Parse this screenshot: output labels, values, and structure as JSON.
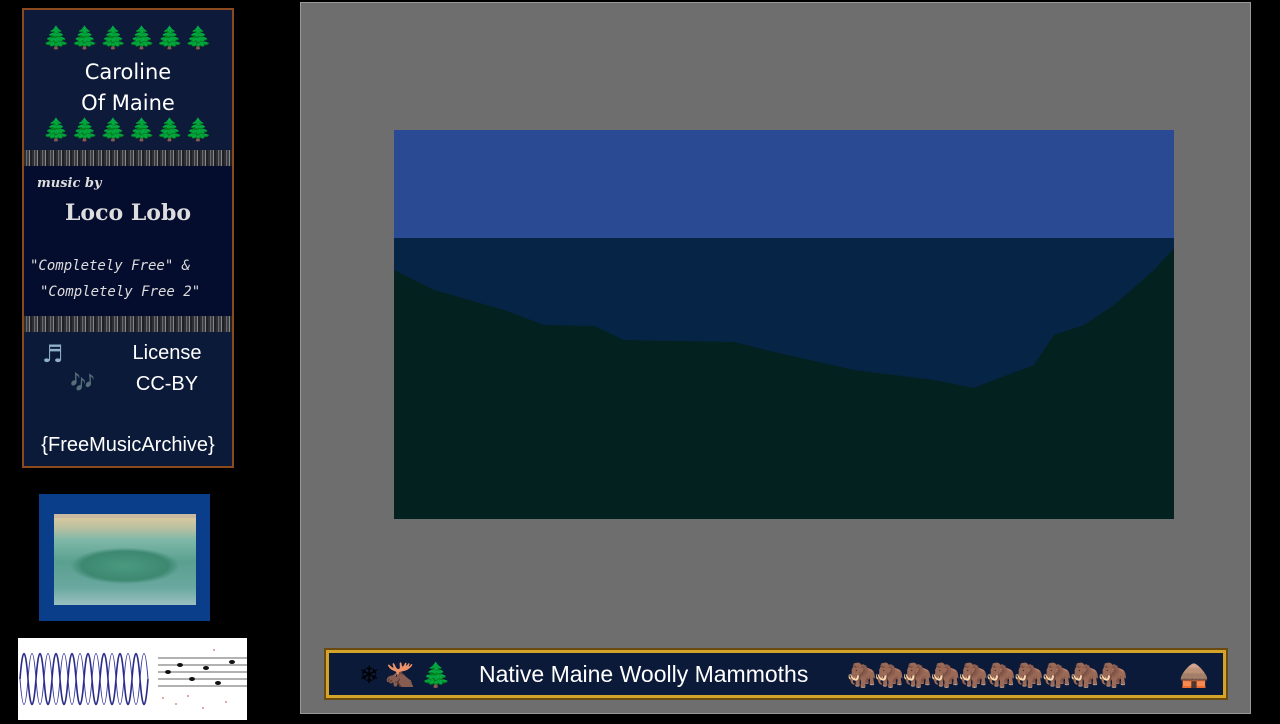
{
  "card": {
    "trees": "🌲🌲🌲🌲🌲🌲",
    "title_line_1": "Caroline",
    "title_line_2": "Of Maine",
    "music_by": "music by",
    "artist": "Loco Lobo",
    "album_line_1": "\"Completely Free\" &",
    "album_line_2": "\"Completely Free 2\"",
    "note_icon_1": "♬",
    "note_icon_2": "🎶",
    "license_label": "License",
    "license_value": "CC-BY",
    "source": "{FreeMusicArchive}"
  },
  "ticker": {
    "icons_left": "❄🫎🌲",
    "text": "Native Maine Woolly Mammoths",
    "icons_right": "🦣🦣🦣🦣🦣🦣🦣🦣🦣🦣",
    "end_icon": "🛖"
  },
  "colors": {
    "sky": "#2a4a94",
    "horizon": "#062445",
    "land": "#03211f",
    "frame_gray": "#6e6e6e",
    "card_border": "#8a4a1e",
    "ticker_border": "#d4a32a",
    "waveform_stroke": "#2a2a8a"
  },
  "icons": {
    "thumbnail": "painting-thumbnail",
    "waveform": "audio-waveform-icon"
  }
}
